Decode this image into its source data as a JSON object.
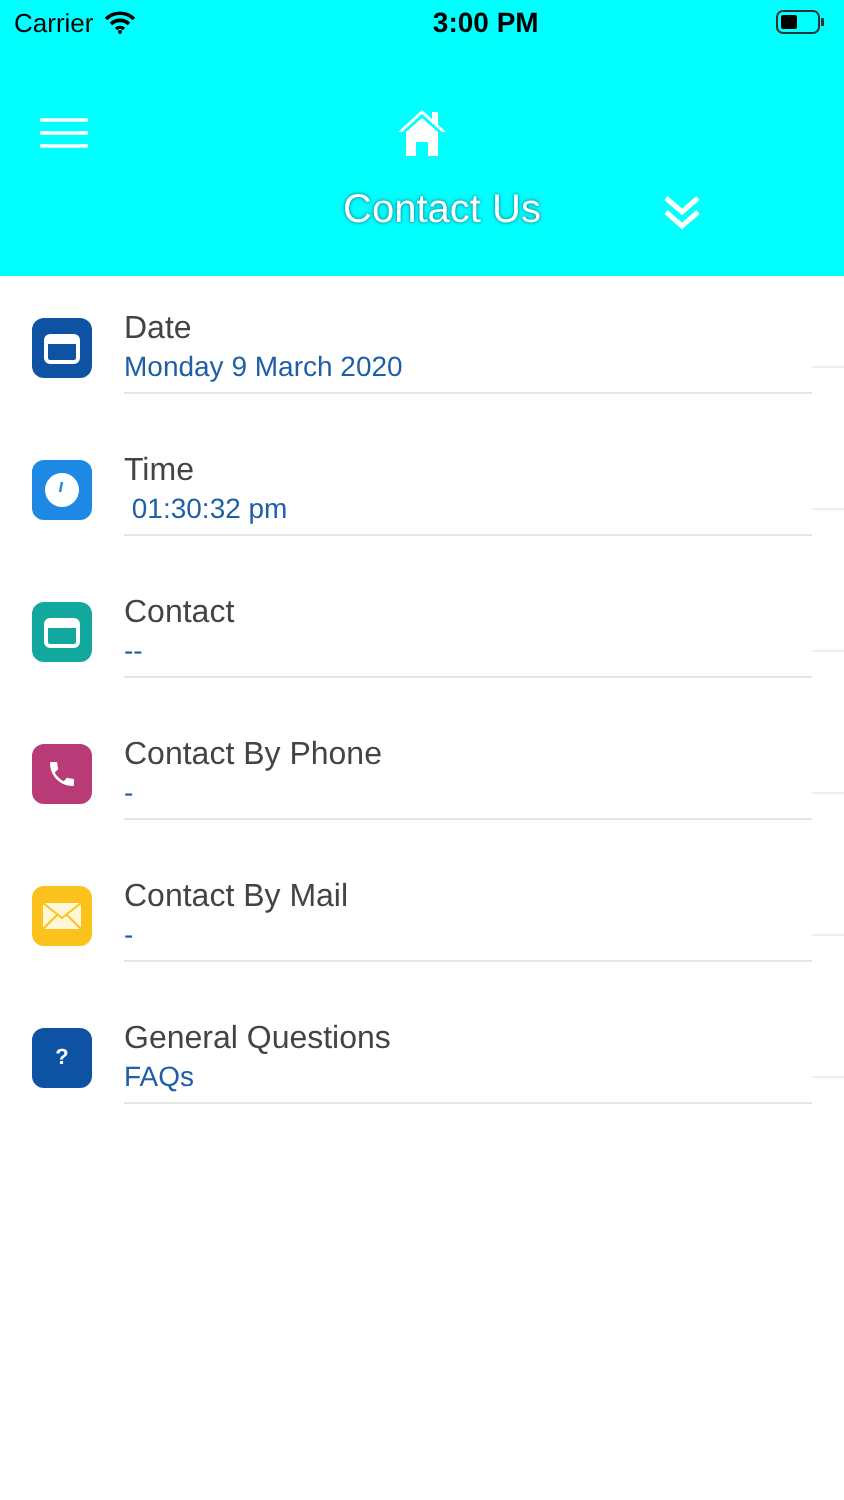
{
  "status_bar": {
    "carrier": "Carrier",
    "time": "3:00 PM"
  },
  "header": {
    "title": "Contact Us"
  },
  "items": [
    {
      "kind": "calendar",
      "color": "#0d52a3",
      "title": "Date",
      "value": "Monday 9 March 2020"
    },
    {
      "kind": "clock",
      "color": "#1e88e5",
      "title": "Time",
      "value": " 01:30:32 pm"
    },
    {
      "kind": "calendar",
      "color": "#13a89e",
      "title": "Contact",
      "value": "--"
    },
    {
      "kind": "phone",
      "color": "#b83a77",
      "title": "Contact By Phone",
      "value": "-"
    },
    {
      "kind": "mail",
      "color": "#fcc21c",
      "title": "Contact By Mail",
      "value": "-"
    },
    {
      "kind": "glyph",
      "glyph": "?",
      "color": "#0d52a3",
      "title": "General Questions",
      "value": "FAQs"
    }
  ]
}
